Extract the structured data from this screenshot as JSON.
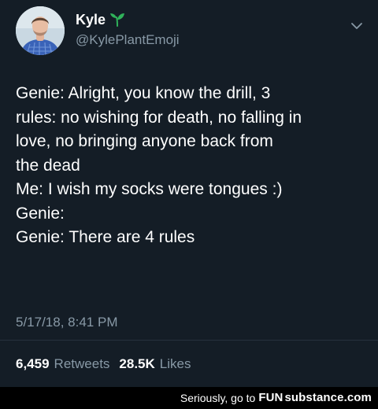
{
  "tweet": {
    "user": {
      "name": "Kyle",
      "handle": "@KylePlantEmoji",
      "icons": {
        "avatar": "avatar-photo",
        "name_badge": "seedling-icon",
        "menu": "chevron-down-icon"
      }
    },
    "text_lines": [
      "Genie: Alright, you know the drill, 3",
      "rules: no wishing for death, no falling in",
      "love, no bringing anyone back from",
      "the dead",
      "Me: I wish my socks were tongues :)",
      "Genie:",
      "Genie: There are 4 rules"
    ],
    "timestamp": "5/17/18, 8:41 PM",
    "stats": {
      "retweets_count": "6,459",
      "retweets_label": "Retweets",
      "likes_count": "28.5K",
      "likes_label": "Likes"
    }
  },
  "footer": {
    "left_text": "Seriously, go to",
    "brand_fun": "FUN",
    "brand_substance": "substance",
    "brand_dotcom": ".com"
  },
  "colors": {
    "background": "#141d26",
    "primary_text": "#ffffff",
    "secondary_text": "#8899a6",
    "divider": "#26313d",
    "footer_bg": "#000000",
    "sprout": "#30b25a"
  }
}
